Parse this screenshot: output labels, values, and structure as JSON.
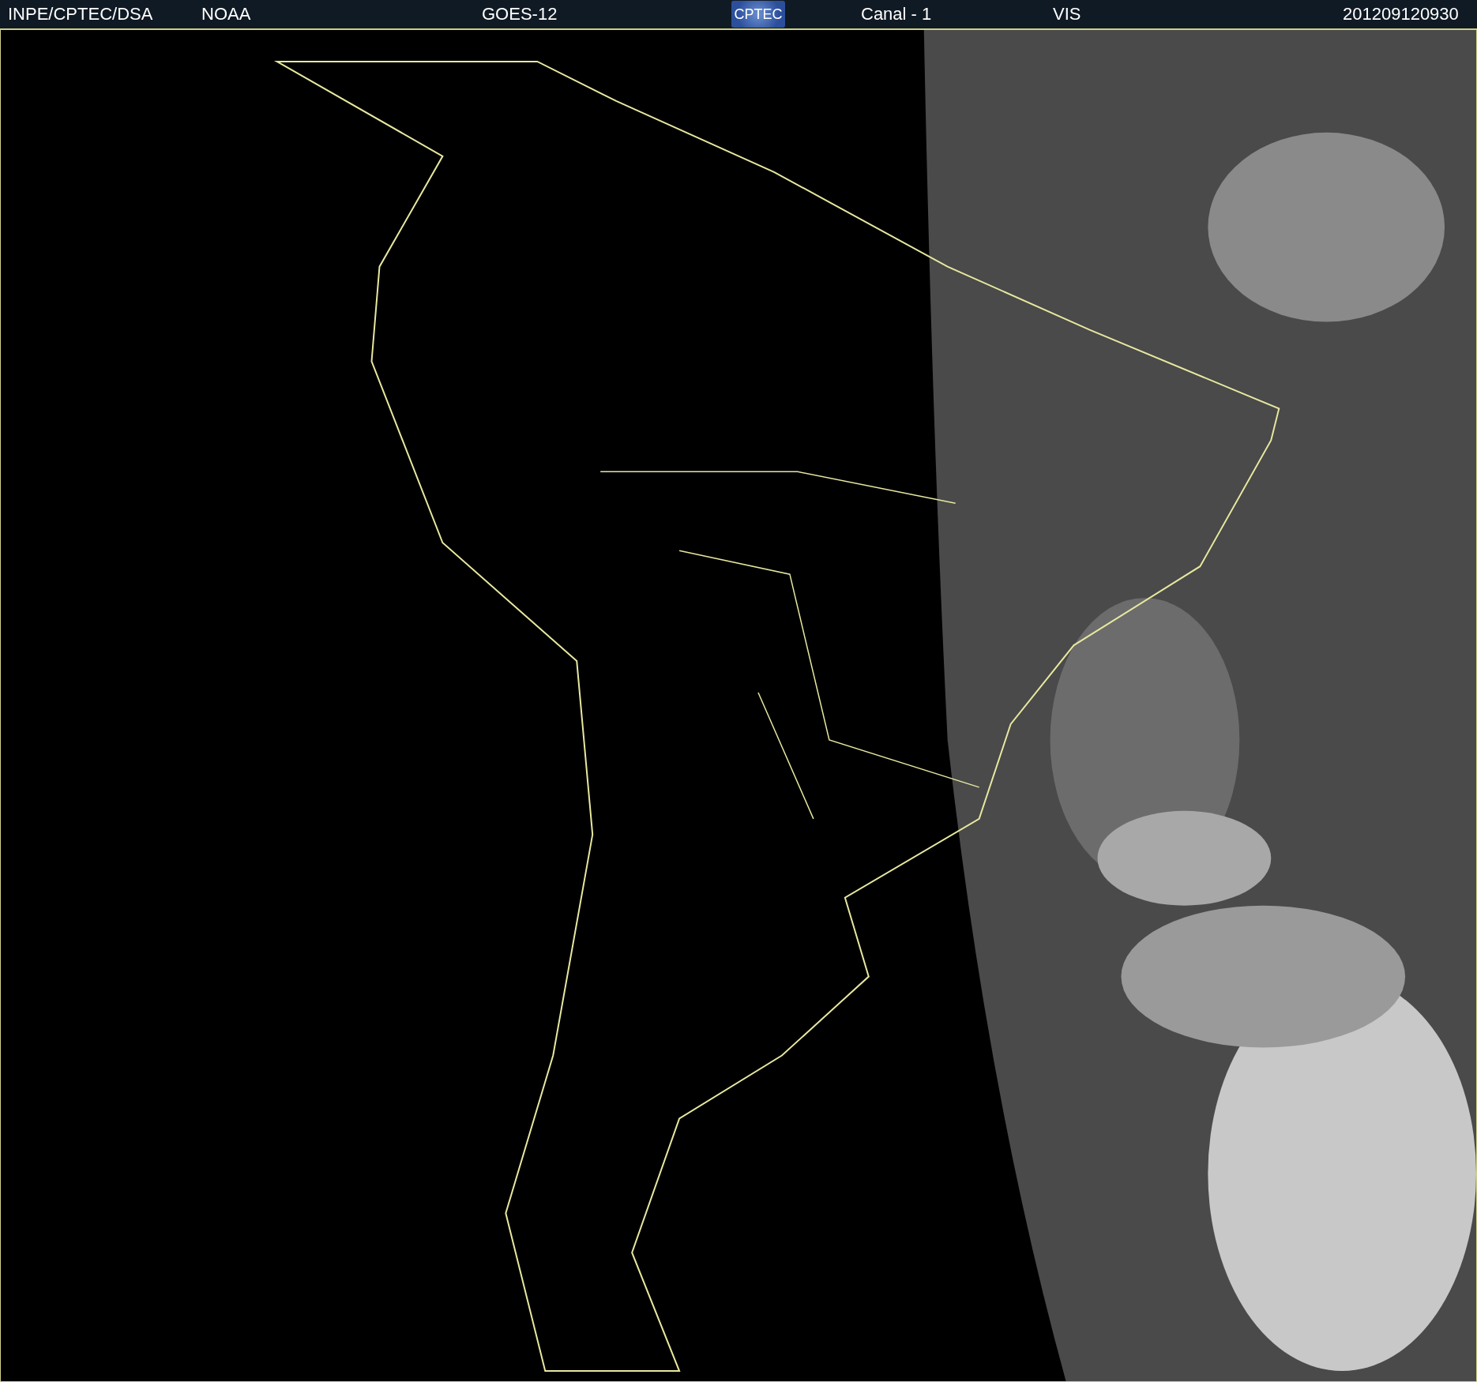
{
  "header": {
    "items": [
      "INPE/CPTEC/DSA",
      "NOAA",
      "GOES-12"
    ],
    "logo": "CPTEC",
    "channel": "Canal - 1",
    "band": "VIS",
    "timestamp": "201209120930"
  }
}
